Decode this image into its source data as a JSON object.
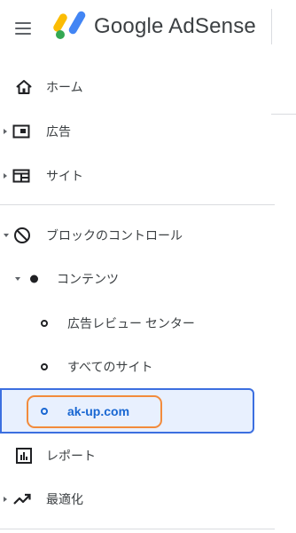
{
  "header": {
    "brand": "Google AdSense",
    "menu_icon": "hamburger-menu-icon",
    "logo_icon": "adsense-logo-icon"
  },
  "colors": {
    "selected_bg": "#e8f0fe",
    "selected_border": "#3c6fe0",
    "selected_text": "#1967d2",
    "annotation_outline": "#f28b3c"
  },
  "nav": {
    "home": {
      "label": "ホーム",
      "icon": "home-icon"
    },
    "ads": {
      "label": "広告",
      "icon": "ad-unit-icon"
    },
    "sites": {
      "label": "サイト",
      "icon": "web-icon"
    },
    "block_controls": {
      "label": "ブロックのコントロール",
      "icon": "block-icon"
    },
    "content": {
      "label": "コンテンツ"
    },
    "ad_review_center": {
      "label": "広告レビュー センター"
    },
    "all_sites": {
      "label": "すべてのサイト"
    },
    "site_ak_up": {
      "label": "ak-up.com",
      "selected": true
    },
    "reports": {
      "label": "レポート",
      "icon": "bar-chart-icon"
    },
    "optimization": {
      "label": "最適化",
      "icon": "trending-up-icon"
    }
  }
}
